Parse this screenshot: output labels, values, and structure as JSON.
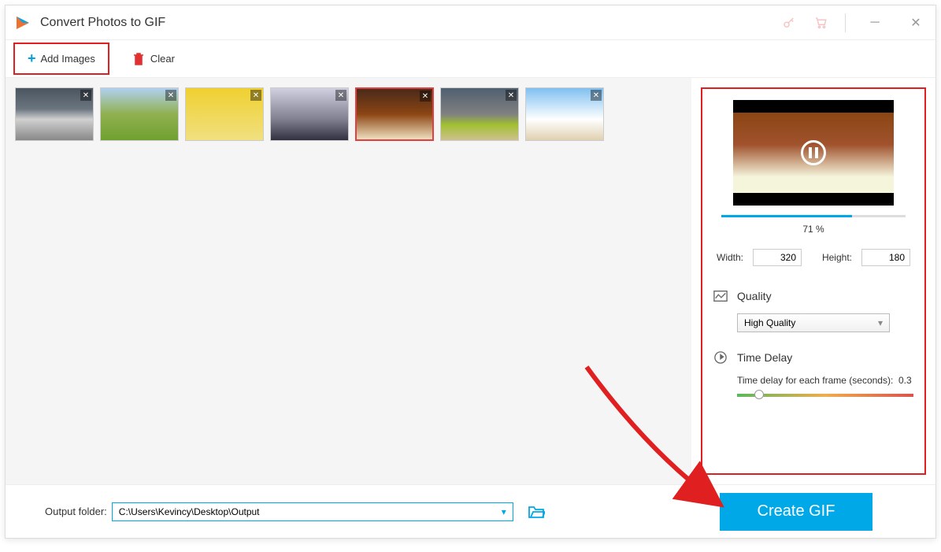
{
  "title": "Convert Photos to GIF",
  "toolbar": {
    "add_images": "Add Images",
    "clear": "Clear"
  },
  "thumbs": [
    {
      "name": "car-photo",
      "selected": false
    },
    {
      "name": "bunny-photo",
      "selected": false
    },
    {
      "name": "minion-photo",
      "selected": false
    },
    {
      "name": "laptop-photo",
      "selected": false
    },
    {
      "name": "bookshelf-photo",
      "selected": true
    },
    {
      "name": "sportscar-photo",
      "selected": false
    },
    {
      "name": "beach-photo",
      "selected": false
    }
  ],
  "preview": {
    "progress_pct": 71,
    "progress_label": "71 %",
    "width_label": "Width:",
    "width_value": "320",
    "height_label": "Height:",
    "height_value": "180"
  },
  "quality": {
    "section_title": "Quality",
    "selected": "High Quality"
  },
  "delay": {
    "section_title": "Time Delay",
    "label": "Time delay for each frame (seconds):",
    "value": "0.3"
  },
  "output": {
    "label": "Output folder:",
    "path": "C:\\Users\\Kevincy\\Desktop\\Output"
  },
  "create_button": "Create GIF"
}
